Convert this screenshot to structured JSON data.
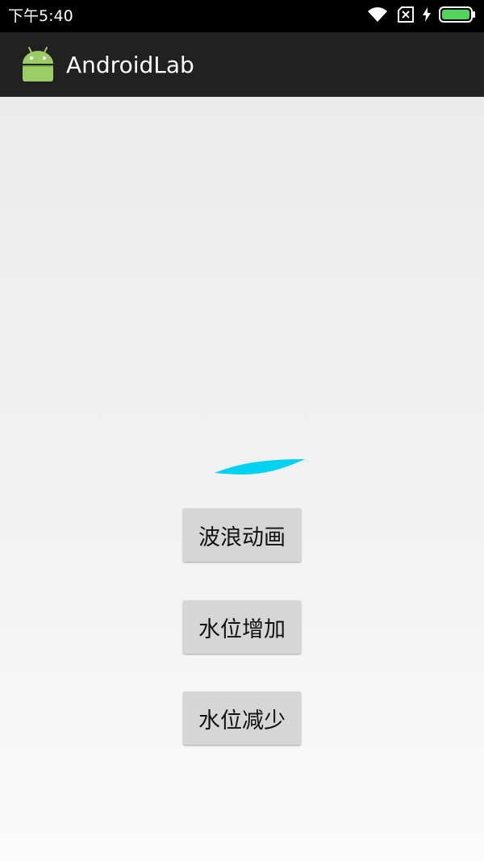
{
  "status_bar": {
    "time": "下午5:40",
    "icons": [
      "wifi-icon",
      "sim-card-blocked-icon",
      "charging-bolt-icon",
      "battery-icon"
    ],
    "battery_color": "#52d35b"
  },
  "app_bar": {
    "title": "AndroidLab",
    "icon": "android-logo-icon",
    "background": "#212121"
  },
  "wave": {
    "color": "#00d2f0",
    "icon": "water-wave-icon"
  },
  "buttons": {
    "wave_animation": "波浪动画",
    "water_level_up": "水位增加",
    "water_level_down": "水位减少"
  }
}
